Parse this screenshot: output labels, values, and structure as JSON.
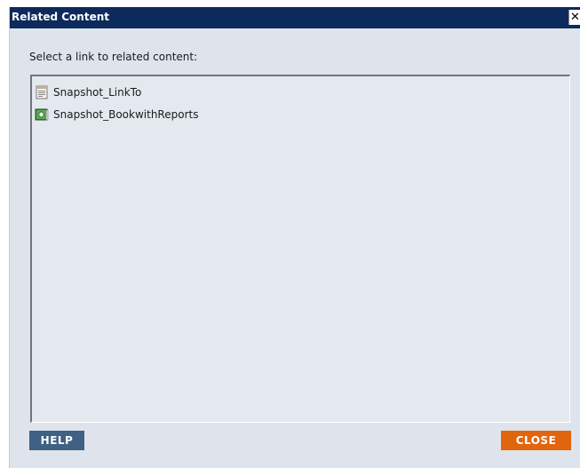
{
  "dialog": {
    "title": "Related Content",
    "close_glyph": "✕",
    "prompt": "Select a link to related content:"
  },
  "links": [
    {
      "label": "Snapshot_LinkTo",
      "icon": "document-report-icon"
    },
    {
      "label": "Snapshot_BookwithReports",
      "icon": "book-icon"
    }
  ],
  "buttons": {
    "help": "HELP",
    "close": "CLOSE"
  },
  "colors": {
    "titlebar": "#0d2a5c",
    "dialog_bg": "#dfe4ec",
    "list_bg": "#e4e8ef",
    "help_button": "#3f6183",
    "close_button": "#e0650e"
  }
}
